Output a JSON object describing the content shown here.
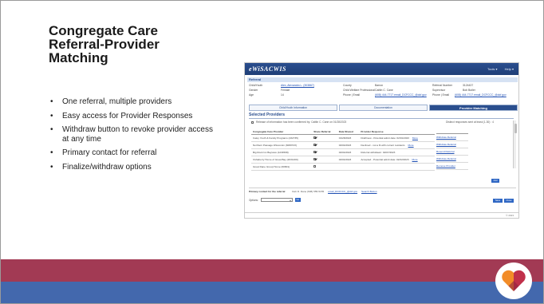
{
  "slide": {
    "title": "Congregate Care Referral-Provider Matching",
    "bullets": [
      "One referral, multiple providers",
      "Easy access for Provider Responses",
      "Withdraw button to revoke provider access at any time",
      "Primary contact for referral",
      "Finalize/withdraw options"
    ]
  },
  "screenshot": {
    "app_title": "eWiSACWIS",
    "nav": [
      "Tools ▾",
      "Help ▾"
    ],
    "referral_section": "Referral",
    "referral_fields": [
      {
        "label": "Child/Youth",
        "value": "Alex, Alexandra L. (303867)",
        "link": true
      },
      {
        "label": "Gender",
        "value": "Female"
      },
      {
        "label": "Age",
        "value": "14"
      },
      {
        "label": "County",
        "value": "Barron"
      },
      {
        "label": "Child Welfare Professional",
        "value": "Caitlin C. Cane"
      },
      {
        "label": "Phone | Email",
        "value": "(608) 444-7717   email_DCFCCC_@dcf.gov"
      },
      {
        "label": "Referral Number",
        "value": "3124437"
      },
      {
        "label": "Supervisor",
        "value": "Bob Butler"
      },
      {
        "label": "Phone | Email",
        "value": "(608) 444-7717   email_DCFCCC_@dcf.gov"
      }
    ],
    "tabs": [
      "Child/Youth Information",
      "Documentation",
      "Provider Matching"
    ],
    "selected_providers_title": "Selected Providers",
    "release_text": "Release of information has been confirmed by: Caitlin C. Cane on 01/28/2023",
    "count_info": "Distinct responses sent at least (1-30) : 4",
    "table_headers": [
      "Congregate Care Provider",
      "Share Referral",
      "Date Shared",
      "Provider Response"
    ],
    "action_header": "",
    "rows": [
      {
        "provider": "Caley Youth & Family Programs (232735)",
        "shared": true,
        "date": "01/28/2023",
        "response": "Draft/new - Potential admit date: 02/01/2023",
        "more": "More",
        "action": "Withdraw Referral"
      },
      {
        "provider": "Northern Passage Wisconsin (308072X)",
        "shared": true,
        "date": "02/04/2023",
        "response": "Declined - not a fit with current residents",
        "more": "More",
        "action": "Withdraw Referral"
      },
      {
        "provider": "Big Rock Inc Bayview (1234568)",
        "shared": true,
        "date": "02/04/2023",
        "response": "Referral withdrawn: 02/07/2023",
        "more": "",
        "action": "Resend Referral"
      },
      {
        "provider": "Oshaberry Home of Great Bay (2031400)",
        "shared": true,
        "date": "02/04/2023",
        "response": "Accepted - Potential admit date: 02/22/2023",
        "more": "More",
        "action": "Withdraw Referral"
      },
      {
        "provider": "Great Dane Group Home (60801)",
        "shared": false,
        "date": "",
        "response": "",
        "more": "",
        "action": "Remove Provider"
      }
    ],
    "add_button": "Add",
    "primary_contact_label": "Primary contact for the referral",
    "primary_contact_text": "Deb D. Dane  (608) 555-5155",
    "primary_contact_email": "email_DCFCCC_@dcf.gov",
    "search_button": "Search Button",
    "options_label": "Options:",
    "go_button": "Go",
    "bottom_buttons": [
      "Save",
      "Close"
    ],
    "footer": "© 2023"
  },
  "colors": {
    "band_red": "#a23a54",
    "band_blue": "#4368ad",
    "logo_heart_orange": "#f28c28",
    "logo_heart_red": "#c0304a"
  }
}
